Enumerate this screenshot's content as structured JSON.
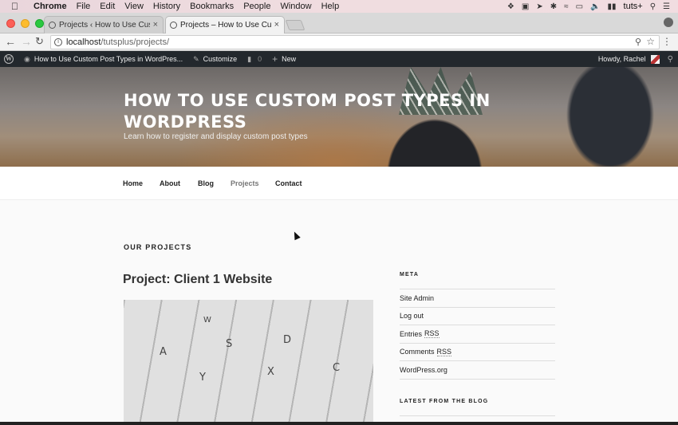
{
  "menubar": {
    "app": "Chrome",
    "items": [
      "File",
      "Edit",
      "View",
      "History",
      "Bookmarks",
      "People",
      "Window",
      "Help"
    ],
    "right_label": "tuts+"
  },
  "tabs": [
    {
      "label": "Projects ‹ How to Use Custom Post Types",
      "active": false
    },
    {
      "label": "Projects – How to Use Custom Post Types",
      "active": true
    }
  ],
  "toolbar": {
    "url_host": "localhost",
    "url_path": "/tutsplus/projects/"
  },
  "adminbar": {
    "site_name": "How to Use Custom Post Types in WordPres...",
    "customize": "Customize",
    "comments_count": "0",
    "new_label": "New",
    "howdy": "Howdy, Rachel"
  },
  "hero": {
    "site_title": "How to Use Custom Post Types in WordPress",
    "tagline": "Learn how to register and display custom post types"
  },
  "nav": {
    "items": [
      {
        "label": "Home",
        "current": false
      },
      {
        "label": "About",
        "current": false
      },
      {
        "label": "Blog",
        "current": false
      },
      {
        "label": "Projects",
        "current": true
      },
      {
        "label": "Contact",
        "current": false
      }
    ]
  },
  "main": {
    "page_header": "OUR PROJECTS",
    "post_title": "Project: Client 1 Website",
    "thumbnail_alt": "keyboard"
  },
  "sidebar": {
    "meta_title": "META",
    "meta_items": [
      {
        "label": "Site Admin",
        "abbr": ""
      },
      {
        "label": "Log out",
        "abbr": ""
      },
      {
        "label": "Entries",
        "abbr": "RSS"
      },
      {
        "label": "Comments",
        "abbr": "RSS"
      },
      {
        "label": "WordPress.org",
        "abbr": ""
      }
    ],
    "latest_title": "LATEST FROM THE BLOG"
  }
}
